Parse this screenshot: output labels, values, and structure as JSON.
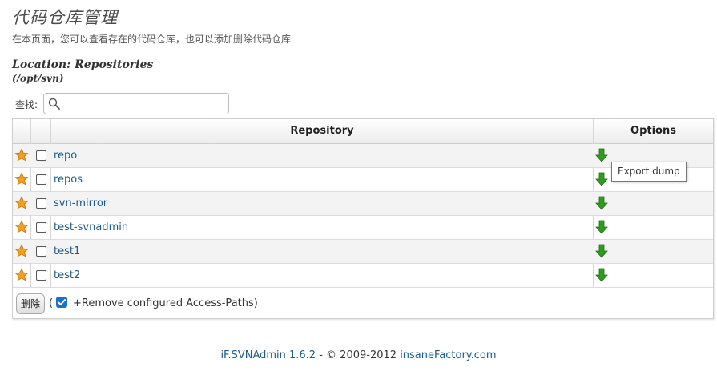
{
  "header": {
    "title": "代码仓库管理",
    "subtitle": "在本页面，您可以查看存在的代码仓库，也可以添加删除代码仓库"
  },
  "location": {
    "label": "Location: Repositories",
    "path": "(/opt/svn)"
  },
  "search": {
    "label": "查找:",
    "value": "",
    "icon": "search-icon"
  },
  "table": {
    "columns": [
      "",
      "",
      "Repository",
      "Options"
    ],
    "rows": [
      {
        "name": "repo",
        "checked": false,
        "icon": "star-icon",
        "option_icon": "download-arrow-icon"
      },
      {
        "name": "repos",
        "checked": false,
        "icon": "star-icon",
        "option_icon": "download-arrow-icon"
      },
      {
        "name": "svn-mirror",
        "checked": false,
        "icon": "star-icon",
        "option_icon": "download-arrow-icon"
      },
      {
        "name": "test-svnadmin",
        "checked": false,
        "icon": "star-icon",
        "option_icon": "download-arrow-icon"
      },
      {
        "name": "test1",
        "checked": false,
        "icon": "star-icon",
        "option_icon": "download-arrow-icon"
      },
      {
        "name": "test2",
        "checked": false,
        "icon": "star-icon",
        "option_icon": "download-arrow-icon"
      }
    ]
  },
  "tooltip": {
    "text": "Export dump"
  },
  "actions": {
    "delete_label": "删除",
    "paren_open": "(",
    "remove_paths_checked": true,
    "remove_paths_label": "+Remove configured Access-Paths)"
  },
  "footer": {
    "app": "iF.SVNAdmin 1.6.2",
    "copyright": " - © 2009-2012 ",
    "vendor": "insaneFactory.com"
  },
  "colors": {
    "link": "#1e5a86",
    "star": "#f0a020",
    "arrow": "#2e9d1e",
    "checkbox_accent": "#1a6fcf"
  }
}
